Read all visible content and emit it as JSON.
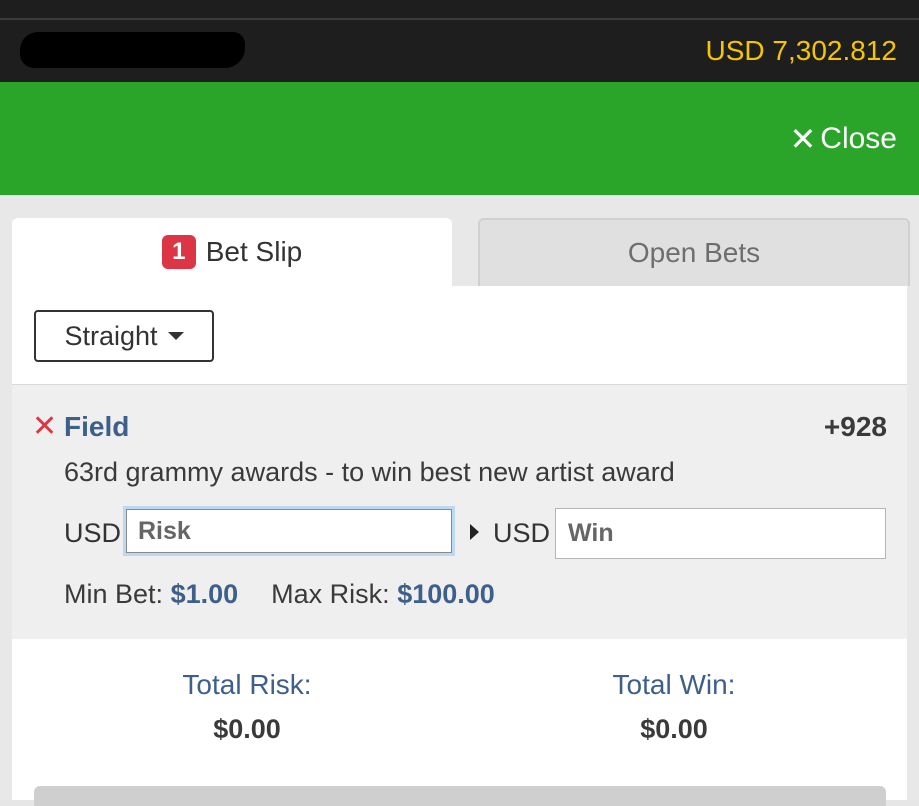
{
  "header": {
    "balance": "USD 7,302.812"
  },
  "close": {
    "label": "Close",
    "icon": "✕"
  },
  "tabs": [
    {
      "label": "Bet Slip",
      "badge": "1",
      "active": true
    },
    {
      "label": "Open Bets",
      "active": false
    }
  ],
  "bet_type": {
    "selected": "Straight"
  },
  "selection": {
    "remove_icon": "✕",
    "name": "Field",
    "odds": "+928",
    "description": "63rd grammy awards - to win best new artist award",
    "risk_currency": "USD",
    "risk_placeholder": "Risk",
    "win_currency": "USD",
    "win_placeholder": "Win",
    "min_bet_label": "Min Bet:",
    "min_bet_value": "$1.00",
    "max_risk_label": "Max Risk:",
    "max_risk_value": "$100.00"
  },
  "totals": {
    "risk_label": "Total Risk:",
    "risk_value": "$0.00",
    "win_label": "Total Win:",
    "win_value": "$0.00"
  },
  "colors": {
    "green_bar": "#2aa52a",
    "balance": "#f5c500",
    "accent_blue": "#3d5f8a",
    "badge_red": "#dc3545"
  }
}
